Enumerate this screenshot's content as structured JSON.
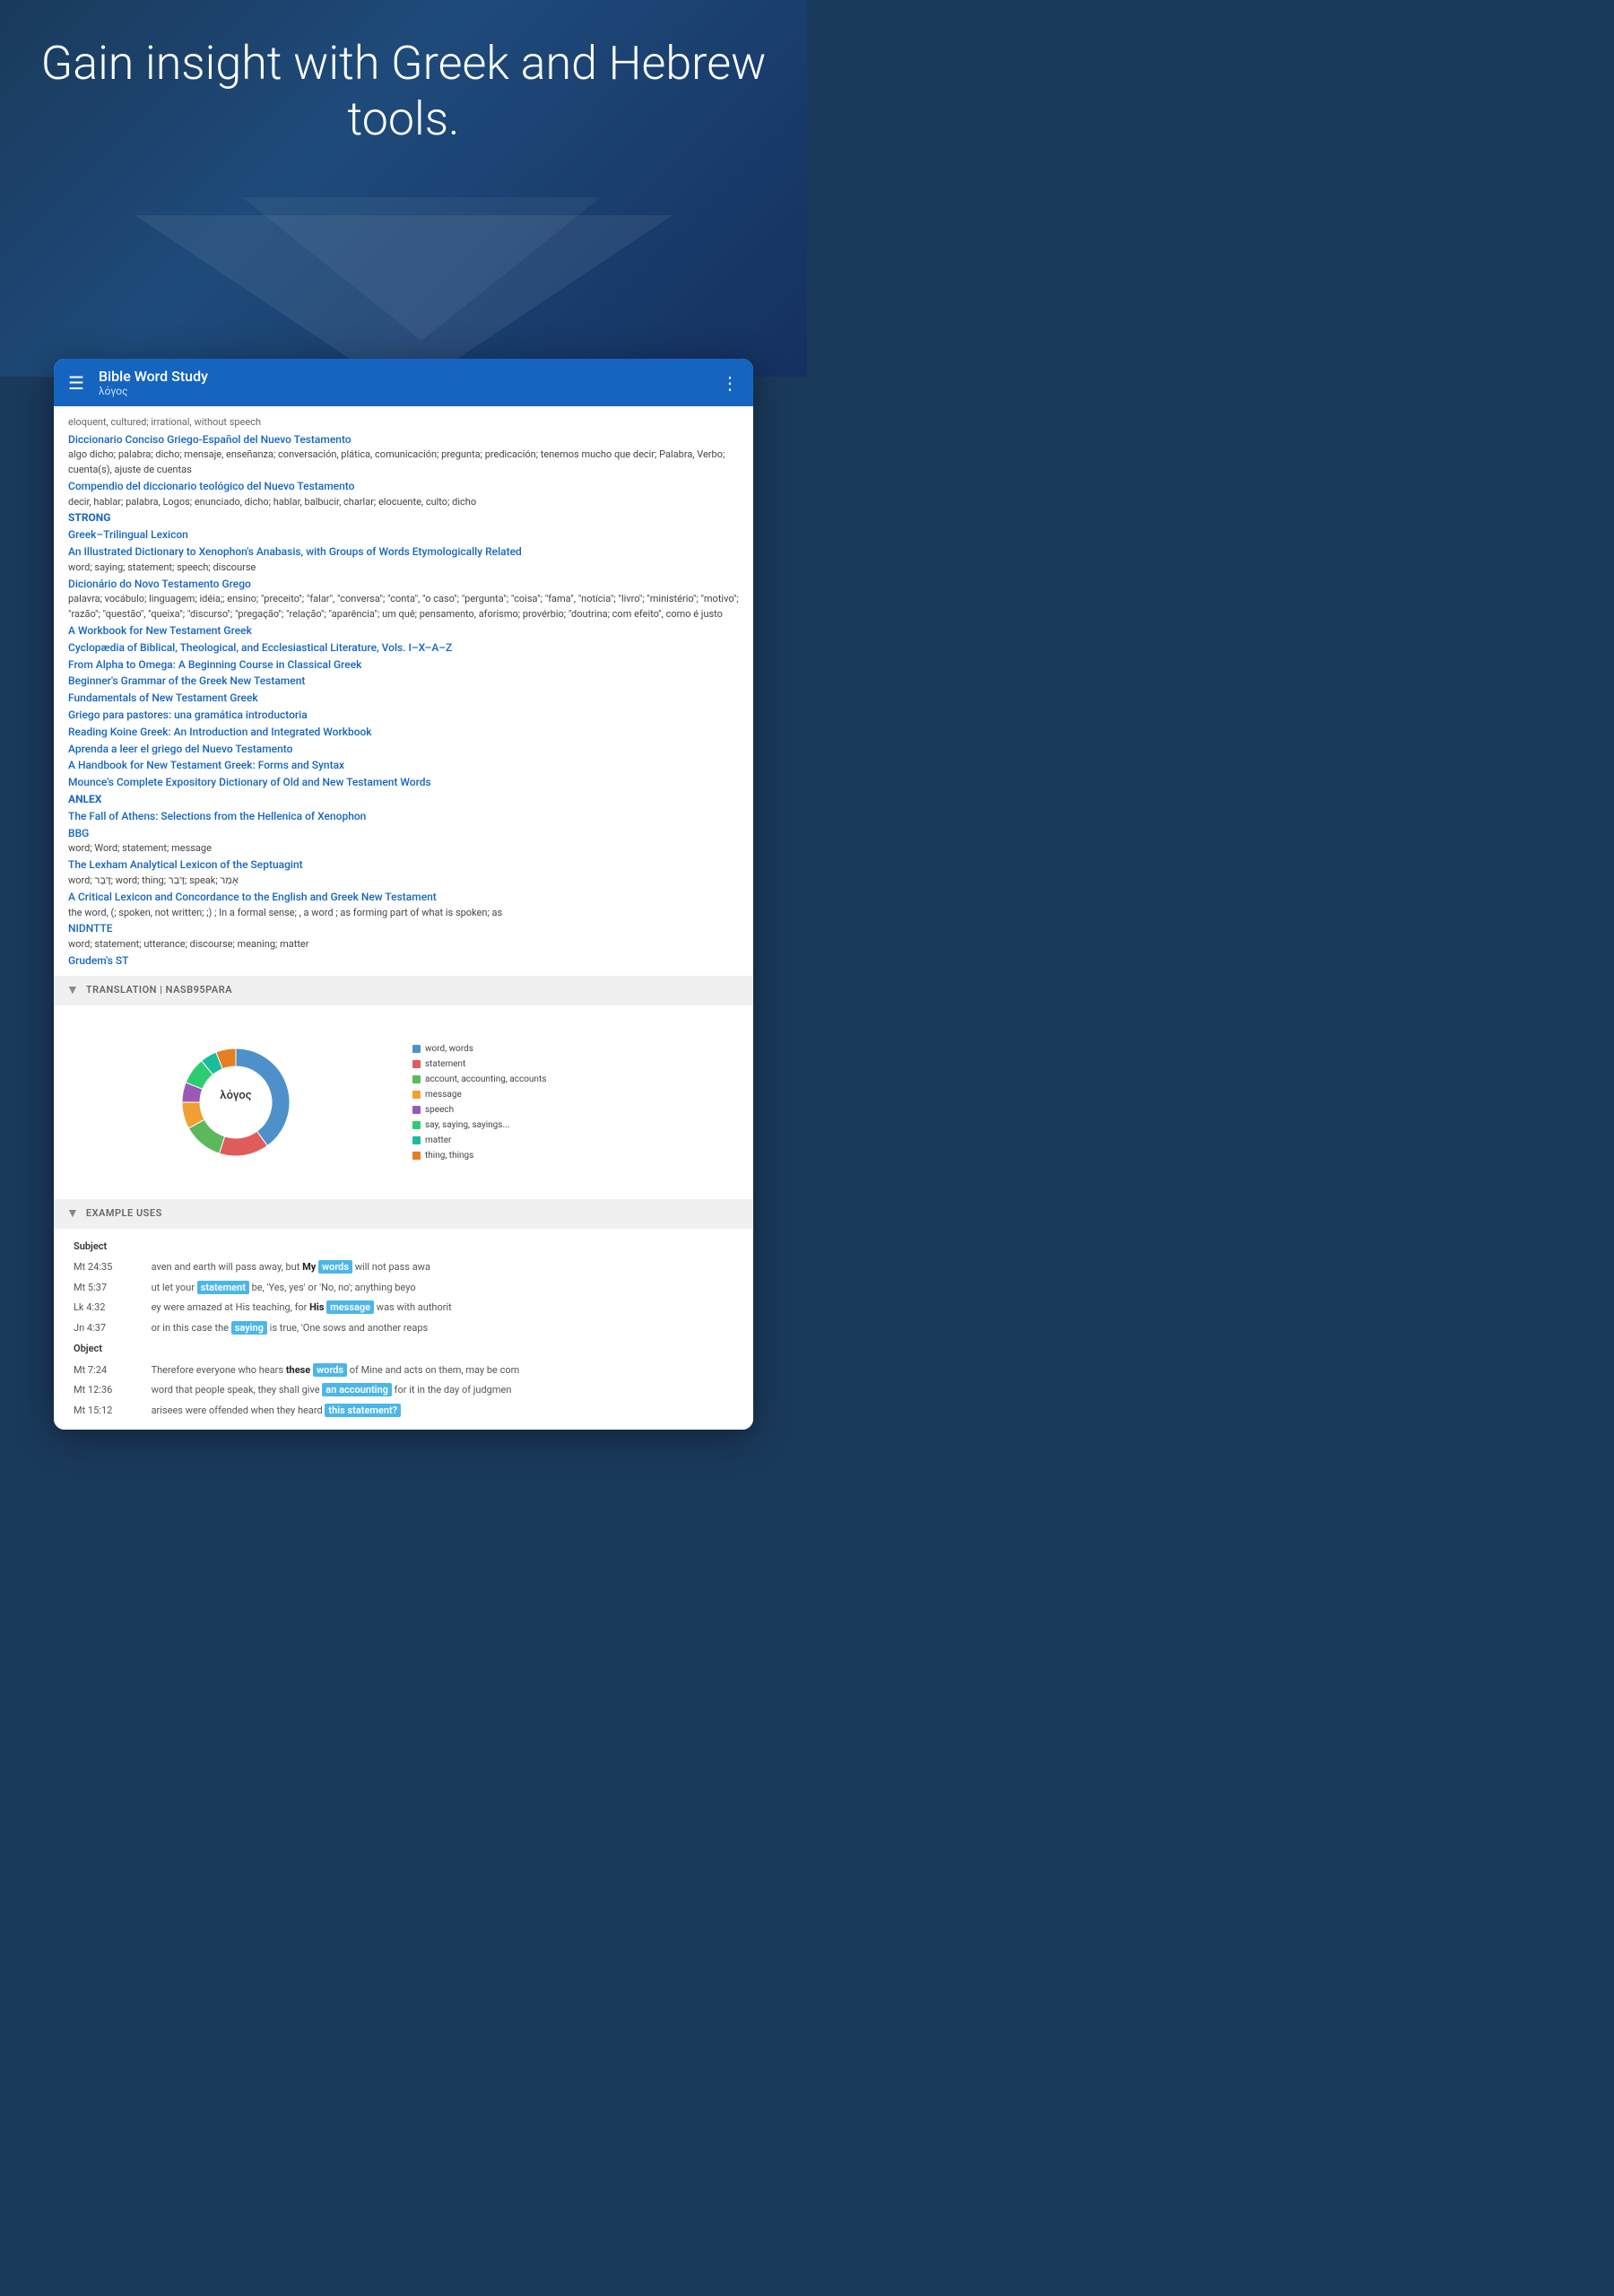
{
  "hero": {
    "title": "Gain insight with Greek and Hebrew tools."
  },
  "app_header": {
    "title": "Bible Word Study",
    "subtitle": "λόγος",
    "hamburger_label": "☰",
    "more_label": "⋮"
  },
  "content": {
    "intro_text": "eloquent, cultured; irrational, without speech",
    "sources": [
      {
        "id": "dcg",
        "link": "Diccionario Conciso Griego-Español del Nuevo Testamento",
        "def": "algo dicho; palabra; dicho; mensaje, enseñanza; conversación, plática, comunicación; pregunta; predicación; tenemos mucho que decir; Palabra, Verbo; cuenta(s), ajuste de cuentas"
      },
      {
        "id": "cdnt",
        "link": "Compendio del diccionario teológico del Nuevo Testamento",
        "def": "decir, hablar; palabra, Logos; enunciado, dicho; hablar, balbucir, charlar; elocuente, culto; dicho"
      },
      {
        "id": "strong",
        "link": "STRONG",
        "def": ""
      },
      {
        "id": "gtl",
        "link": "Greek–Trilingual Lexicon",
        "def": ""
      },
      {
        "id": "xenophon",
        "link": "An Illustrated Dictionary to Xenophon's Anabasis, with Groups of Words Etymologically Related",
        "def": "word; saying; statement; speech; discourse"
      },
      {
        "id": "dntg",
        "link": "Dicionário do Novo Testamento Grego",
        "def": "palavra; vocábulo; linguagem; idéia;; ensino; \"preceito\"; \"falar\", \"conversa\"; \"conta\", \"o caso\"; \"pergunta\"; \"coisa\"; \"fama\", \"notícia\"; \"livro\"; \"ministério\"; \"motivo\"; \"razão\"; \"questão\", \"queixa\"; \"discurso\"; \"pregação\"; \"relação\"; \"aparência\"; um quê; pensamento, aforismo; provérbio; \"doutrina; com efeito\", como é justo"
      },
      {
        "id": "wbntg",
        "link": "A Workbook for New Testament Greek",
        "def": ""
      },
      {
        "id": "cyclo",
        "link": "Cyclopædia of Biblical, Theological, and Ecclesiastical Literature, Vols. I–X–A–Z",
        "def": ""
      },
      {
        "id": "alpha",
        "link": "From Alpha to Omega: A Beginning Course in Classical Greek",
        "def": ""
      },
      {
        "id": "beginner",
        "link": "Beginner's Grammar of the Greek New Testament",
        "def": ""
      },
      {
        "id": "fund",
        "link": "Fundamentals of New Testament Greek",
        "def": ""
      },
      {
        "id": "griego",
        "link": "Griego para pastores: una gramática introductoria",
        "def": ""
      },
      {
        "id": "reading",
        "link": "Reading Koine Greek: An Introduction and Integrated Workbook",
        "def": ""
      },
      {
        "id": "aprenda",
        "link": "Aprenda a leer el griego del Nuevo Testamento",
        "def": ""
      },
      {
        "id": "handbook",
        "link": "A Handbook for New Testament Greek: Forms and Syntax",
        "def": ""
      },
      {
        "id": "mounce",
        "link": "Mounce's Complete Expository Dictionary of Old and New Testament Words",
        "def": ""
      },
      {
        "id": "anlex",
        "link": "ANLEX",
        "def": ""
      },
      {
        "id": "fall",
        "link": "The Fall of Athens: Selections from the Hellenica of Xenophon",
        "def": ""
      },
      {
        "id": "bbg",
        "link": "BBG",
        "def": "word; Word; statement; message"
      },
      {
        "id": "lexham",
        "link": "The Lexham Analytical Lexicon of the Septuagint",
        "def": "word; דָּבָר; word; thing; דָּבַר; speak; אָמַר"
      },
      {
        "id": "critical",
        "link": "A Critical Lexicon and Concordance to the English and Greek New Testament",
        "def": "the word, (; spoken, not written; ;) ; In a formal sense; , a word ; as forming part of what is spoken; as"
      },
      {
        "id": "nidntte",
        "link": "NIDNTTE",
        "def": "word; statement; utterance; discourse; meaning; matter"
      },
      {
        "id": "grudem",
        "link": "Grudem's ST",
        "def": ""
      }
    ],
    "translation_section": {
      "label": "TRANSLATION | NASB95PARA"
    },
    "chart": {
      "center_label": "λόγος",
      "legend": [
        {
          "color": "#4e90ca",
          "label": "word, words"
        },
        {
          "color": "#e05c5c",
          "label": "statement"
        },
        {
          "color": "#5cb85c",
          "label": "account, accounting, accounts"
        },
        {
          "color": "#f0a030",
          "label": "message"
        },
        {
          "color": "#9b59b6",
          "label": "speech"
        },
        {
          "color": "#2ecc71",
          "label": "say, saying, sayings..."
        },
        {
          "color": "#1abc9c",
          "label": "matter"
        },
        {
          "color": "#e67e22",
          "label": "thing, things"
        }
      ],
      "segments": [
        {
          "color": "#4e90ca",
          "percent": 40
        },
        {
          "color": "#e05c5c",
          "percent": 15
        },
        {
          "color": "#5cb85c",
          "percent": 12
        },
        {
          "color": "#f0a030",
          "percent": 8
        },
        {
          "color": "#9b59b6",
          "percent": 6
        },
        {
          "color": "#2ecc71",
          "percent": 8
        },
        {
          "color": "#1abc9c",
          "percent": 5
        },
        {
          "color": "#e67e22",
          "percent": 6
        }
      ]
    },
    "example_uses": {
      "label": "EXAMPLE USES",
      "headers": [
        "Subject",
        ""
      ],
      "rows": [
        {
          "ref": "Mt 24:35",
          "before": "aven and earth will pass away, but",
          "highlight_prefix": "My",
          "highlight": "words",
          "after": "will not pass awa"
        },
        {
          "ref": "Mt 5:37",
          "before": "ut let your",
          "highlight": "statement",
          "after": "be, 'Yes, yes' or 'No, no'; anything beyo"
        },
        {
          "ref": "Lk 4:32",
          "before": "ey were amazed at His teaching, for",
          "highlight_prefix": "His",
          "highlight": "message",
          "after": "was with authorit"
        },
        {
          "ref": "Jn 4:37",
          "before": "or in this case the",
          "highlight": "saying",
          "after": "is true, 'One sows and another reaps"
        },
        {
          "section": "Object"
        },
        {
          "ref": "Mt 7:24",
          "before": "Therefore everyone who hears",
          "highlight_prefix": "these",
          "highlight": "words",
          "after": "of Mine and acts on them, may be com"
        },
        {
          "ref": "Mt 12:36",
          "before": "word that people speak, they shall give",
          "highlight": "an accounting",
          "after": "for it in the day of judgmen"
        },
        {
          "ref": "Mt 15:12",
          "before": "arisees were offended when they heard",
          "highlight": "this statement?",
          "after": ""
        }
      ]
    }
  }
}
